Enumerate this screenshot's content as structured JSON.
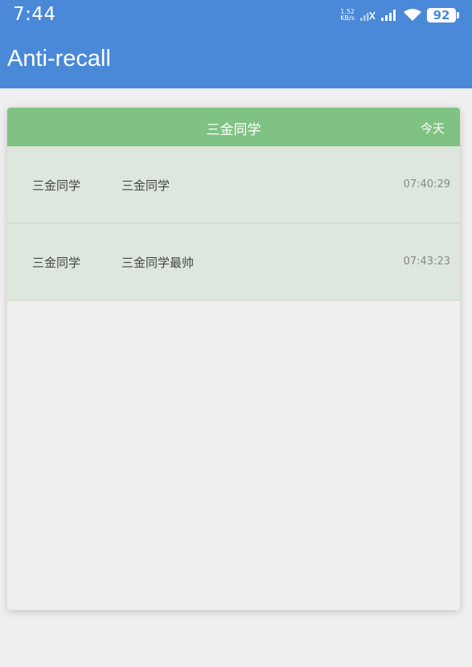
{
  "status_bar": {
    "time": "7:44",
    "net_speed_value": "1.52",
    "net_speed_unit": "KB/s",
    "battery": "92"
  },
  "app_bar": {
    "title": "Anti-recall"
  },
  "card": {
    "title": "三金同学",
    "date": "今天",
    "messages": [
      {
        "sender": "三金同学",
        "content": "三金同学",
        "time": "07:40:29"
      },
      {
        "sender": "三金同学",
        "content": "三金同学最帅",
        "time": "07:43:23"
      }
    ]
  },
  "colors": {
    "primary": "#4a89d8",
    "header_green": "#80c283",
    "row_green": "#dde7dd",
    "background": "#efefef"
  }
}
